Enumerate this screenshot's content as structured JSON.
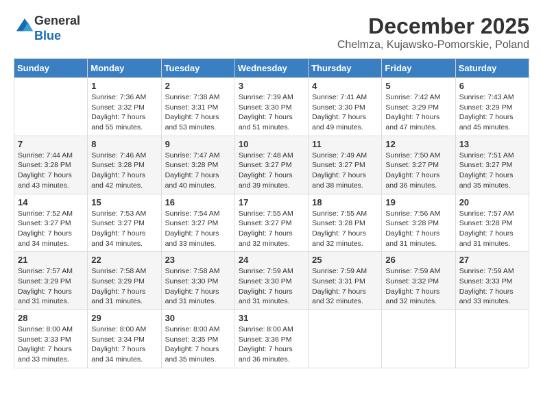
{
  "header": {
    "logo_line1": "General",
    "logo_line2": "Blue",
    "month": "December 2025",
    "location": "Chelmza, Kujawsko-Pomorskie, Poland"
  },
  "weekdays": [
    "Sunday",
    "Monday",
    "Tuesday",
    "Wednesday",
    "Thursday",
    "Friday",
    "Saturday"
  ],
  "weeks": [
    [
      {
        "day": "",
        "sunrise": "",
        "sunset": "",
        "daylight": ""
      },
      {
        "day": "1",
        "sunrise": "Sunrise: 7:36 AM",
        "sunset": "Sunset: 3:32 PM",
        "daylight": "Daylight: 7 hours and 55 minutes."
      },
      {
        "day": "2",
        "sunrise": "Sunrise: 7:38 AM",
        "sunset": "Sunset: 3:31 PM",
        "daylight": "Daylight: 7 hours and 53 minutes."
      },
      {
        "day": "3",
        "sunrise": "Sunrise: 7:39 AM",
        "sunset": "Sunset: 3:30 PM",
        "daylight": "Daylight: 7 hours and 51 minutes."
      },
      {
        "day": "4",
        "sunrise": "Sunrise: 7:41 AM",
        "sunset": "Sunset: 3:30 PM",
        "daylight": "Daylight: 7 hours and 49 minutes."
      },
      {
        "day": "5",
        "sunrise": "Sunrise: 7:42 AM",
        "sunset": "Sunset: 3:29 PM",
        "daylight": "Daylight: 7 hours and 47 minutes."
      },
      {
        "day": "6",
        "sunrise": "Sunrise: 7:43 AM",
        "sunset": "Sunset: 3:29 PM",
        "daylight": "Daylight: 7 hours and 45 minutes."
      }
    ],
    [
      {
        "day": "7",
        "sunrise": "Sunrise: 7:44 AM",
        "sunset": "Sunset: 3:28 PM",
        "daylight": "Daylight: 7 hours and 43 minutes."
      },
      {
        "day": "8",
        "sunrise": "Sunrise: 7:46 AM",
        "sunset": "Sunset: 3:28 PM",
        "daylight": "Daylight: 7 hours and 42 minutes."
      },
      {
        "day": "9",
        "sunrise": "Sunrise: 7:47 AM",
        "sunset": "Sunset: 3:28 PM",
        "daylight": "Daylight: 7 hours and 40 minutes."
      },
      {
        "day": "10",
        "sunrise": "Sunrise: 7:48 AM",
        "sunset": "Sunset: 3:27 PM",
        "daylight": "Daylight: 7 hours and 39 minutes."
      },
      {
        "day": "11",
        "sunrise": "Sunrise: 7:49 AM",
        "sunset": "Sunset: 3:27 PM",
        "daylight": "Daylight: 7 hours and 38 minutes."
      },
      {
        "day": "12",
        "sunrise": "Sunrise: 7:50 AM",
        "sunset": "Sunset: 3:27 PM",
        "daylight": "Daylight: 7 hours and 36 minutes."
      },
      {
        "day": "13",
        "sunrise": "Sunrise: 7:51 AM",
        "sunset": "Sunset: 3:27 PM",
        "daylight": "Daylight: 7 hours and 35 minutes."
      }
    ],
    [
      {
        "day": "14",
        "sunrise": "Sunrise: 7:52 AM",
        "sunset": "Sunset: 3:27 PM",
        "daylight": "Daylight: 7 hours and 34 minutes."
      },
      {
        "day": "15",
        "sunrise": "Sunrise: 7:53 AM",
        "sunset": "Sunset: 3:27 PM",
        "daylight": "Daylight: 7 hours and 34 minutes."
      },
      {
        "day": "16",
        "sunrise": "Sunrise: 7:54 AM",
        "sunset": "Sunset: 3:27 PM",
        "daylight": "Daylight: 7 hours and 33 minutes."
      },
      {
        "day": "17",
        "sunrise": "Sunrise: 7:55 AM",
        "sunset": "Sunset: 3:27 PM",
        "daylight": "Daylight: 7 hours and 32 minutes."
      },
      {
        "day": "18",
        "sunrise": "Sunrise: 7:55 AM",
        "sunset": "Sunset: 3:28 PM",
        "daylight": "Daylight: 7 hours and 32 minutes."
      },
      {
        "day": "19",
        "sunrise": "Sunrise: 7:56 AM",
        "sunset": "Sunset: 3:28 PM",
        "daylight": "Daylight: 7 hours and 31 minutes."
      },
      {
        "day": "20",
        "sunrise": "Sunrise: 7:57 AM",
        "sunset": "Sunset: 3:28 PM",
        "daylight": "Daylight: 7 hours and 31 minutes."
      }
    ],
    [
      {
        "day": "21",
        "sunrise": "Sunrise: 7:57 AM",
        "sunset": "Sunset: 3:29 PM",
        "daylight": "Daylight: 7 hours and 31 minutes."
      },
      {
        "day": "22",
        "sunrise": "Sunrise: 7:58 AM",
        "sunset": "Sunset: 3:29 PM",
        "daylight": "Daylight: 7 hours and 31 minutes."
      },
      {
        "day": "23",
        "sunrise": "Sunrise: 7:58 AM",
        "sunset": "Sunset: 3:30 PM",
        "daylight": "Daylight: 7 hours and 31 minutes."
      },
      {
        "day": "24",
        "sunrise": "Sunrise: 7:59 AM",
        "sunset": "Sunset: 3:30 PM",
        "daylight": "Daylight: 7 hours and 31 minutes."
      },
      {
        "day": "25",
        "sunrise": "Sunrise: 7:59 AM",
        "sunset": "Sunset: 3:31 PM",
        "daylight": "Daylight: 7 hours and 32 minutes."
      },
      {
        "day": "26",
        "sunrise": "Sunrise: 7:59 AM",
        "sunset": "Sunset: 3:32 PM",
        "daylight": "Daylight: 7 hours and 32 minutes."
      },
      {
        "day": "27",
        "sunrise": "Sunrise: 7:59 AM",
        "sunset": "Sunset: 3:33 PM",
        "daylight": "Daylight: 7 hours and 33 minutes."
      }
    ],
    [
      {
        "day": "28",
        "sunrise": "Sunrise: 8:00 AM",
        "sunset": "Sunset: 3:33 PM",
        "daylight": "Daylight: 7 hours and 33 minutes."
      },
      {
        "day": "29",
        "sunrise": "Sunrise: 8:00 AM",
        "sunset": "Sunset: 3:34 PM",
        "daylight": "Daylight: 7 hours and 34 minutes."
      },
      {
        "day": "30",
        "sunrise": "Sunrise: 8:00 AM",
        "sunset": "Sunset: 3:35 PM",
        "daylight": "Daylight: 7 hours and 35 minutes."
      },
      {
        "day": "31",
        "sunrise": "Sunrise: 8:00 AM",
        "sunset": "Sunset: 3:36 PM",
        "daylight": "Daylight: 7 hours and 36 minutes."
      },
      {
        "day": "",
        "sunrise": "",
        "sunset": "",
        "daylight": ""
      },
      {
        "day": "",
        "sunrise": "",
        "sunset": "",
        "daylight": ""
      },
      {
        "day": "",
        "sunrise": "",
        "sunset": "",
        "daylight": ""
      }
    ]
  ]
}
